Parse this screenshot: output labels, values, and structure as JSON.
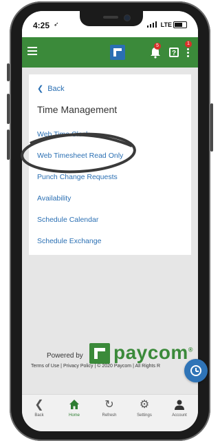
{
  "status_bar": {
    "time": "4:25",
    "network": "LTE"
  },
  "app_bar": {
    "notification_count": "5",
    "menu_badge_count": "1",
    "help_label": "?"
  },
  "card": {
    "back_label": "Back",
    "title": "Time Management",
    "items": [
      {
        "label": "Web Time Clock"
      },
      {
        "label": "Web Timesheet Read Only"
      },
      {
        "label": "Punch Change Requests"
      },
      {
        "label": "Availability"
      },
      {
        "label": "Schedule Calendar"
      },
      {
        "label": "Schedule Exchange"
      }
    ]
  },
  "branding": {
    "powered_by": "Powered by",
    "brand": "paycom",
    "brand_mark": "®"
  },
  "footer": {
    "text": "Terms of Use | Privacy Policy | © 2020 Paycom | All Rights R"
  },
  "tabs": [
    {
      "label": "Back",
      "icon": "chevron-left-icon"
    },
    {
      "label": "Home",
      "icon": "home-icon",
      "active": true
    },
    {
      "label": "Refresh",
      "icon": "refresh-icon"
    },
    {
      "label": "Settings",
      "icon": "gear-icon"
    },
    {
      "label": "Account",
      "icon": "person-icon"
    }
  ],
  "colors": {
    "brand_green": "#3b8a3a",
    "link_blue": "#2a6fb3",
    "badge_red": "#d9302a",
    "fab_blue": "#2f74b7"
  }
}
